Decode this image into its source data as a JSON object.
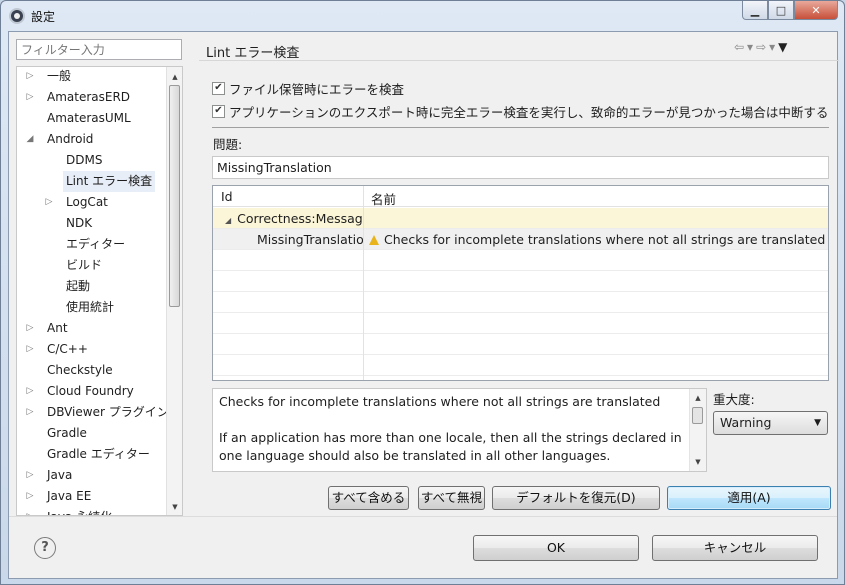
{
  "window": {
    "title": "設定"
  },
  "filter": {
    "placeholder": "フィルター入力"
  },
  "tree": [
    {
      "label": "一般",
      "level": 0,
      "twisty": "collapsed"
    },
    {
      "label": "AmaterasERD",
      "level": 0,
      "twisty": "collapsed"
    },
    {
      "label": "AmaterasUML",
      "level": 0,
      "twisty": "none"
    },
    {
      "label": "Android",
      "level": 0,
      "twisty": "expanded"
    },
    {
      "label": "DDMS",
      "level": 1,
      "twisty": "none"
    },
    {
      "label": "Lint エラー検査",
      "level": 1,
      "twisty": "none",
      "selected": true
    },
    {
      "label": "LogCat",
      "level": 1,
      "twisty": "collapsed"
    },
    {
      "label": "NDK",
      "level": 1,
      "twisty": "none"
    },
    {
      "label": "エディター",
      "level": 1,
      "twisty": "none"
    },
    {
      "label": "ビルド",
      "level": 1,
      "twisty": "none"
    },
    {
      "label": "起動",
      "level": 1,
      "twisty": "none"
    },
    {
      "label": "使用統計",
      "level": 1,
      "twisty": "none"
    },
    {
      "label": "Ant",
      "level": 0,
      "twisty": "collapsed"
    },
    {
      "label": "C/C++",
      "level": 0,
      "twisty": "collapsed"
    },
    {
      "label": "Checkstyle",
      "level": 0,
      "twisty": "none"
    },
    {
      "label": "Cloud Foundry",
      "level": 0,
      "twisty": "collapsed"
    },
    {
      "label": "DBViewer プラグイン",
      "level": 0,
      "twisty": "collapsed"
    },
    {
      "label": "Gradle",
      "level": 0,
      "twisty": "none"
    },
    {
      "label": "Gradle エディター",
      "level": 0,
      "twisty": "none"
    },
    {
      "label": "Java",
      "level": 0,
      "twisty": "collapsed"
    },
    {
      "label": "Java EE",
      "level": 0,
      "twisty": "collapsed"
    },
    {
      "label": "Java 永続化",
      "level": 0,
      "twisty": "collapsed"
    }
  ],
  "page": {
    "title": "Lint エラー検査",
    "check_save": "ファイル保管時にエラーを検査",
    "check_export": "アプリケーションのエクスポート時に完全エラー検査を実行し、致命的エラーが見つかった場合は中断する",
    "issues_label": "問題:",
    "issue_filter_value": "MissingTranslation",
    "table": {
      "col_id": "Id",
      "col_name": "名前",
      "category": "Correctness:Messages",
      "row_id": "MissingTranslation",
      "row_name": "Checks for incomplete translations where not all strings are translated"
    },
    "description": {
      "line1": "Checks for incomplete translations where not all strings are translated",
      "line2": "If an application has more than one locale, then all the strings declared in one language should also be translated in all other languages."
    },
    "severity_label": "重大度:",
    "severity_value": "Warning",
    "buttons": {
      "include_all": "すべて含める",
      "ignore_all": "すべて無視",
      "restore_defaults": "デフォルトを復元(D)",
      "apply": "適用(A)",
      "ok": "OK",
      "cancel": "キャンセル"
    }
  }
}
